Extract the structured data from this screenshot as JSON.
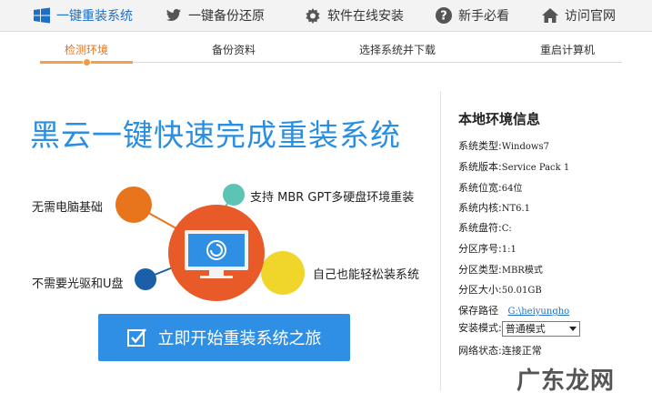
{
  "toolbar": {
    "items": [
      {
        "label": "一键重装系统",
        "icon": "windows-logo-icon"
      },
      {
        "label": "一键备份还原",
        "icon": "twitter-bird-icon"
      },
      {
        "label": "软件在线安装",
        "icon": "gear-icon"
      },
      {
        "label": "新手必看",
        "icon": "help-icon"
      },
      {
        "label": "访问官网",
        "icon": "home-icon"
      }
    ]
  },
  "steps": {
    "items": [
      "检测环境",
      "备份资料",
      "选择系统并下载",
      "重启计算机"
    ],
    "active_index": 0
  },
  "main": {
    "headline": "黑云一键快速完成重装系统",
    "features": {
      "no_skill": "无需电脑基础",
      "no_drive": "不需要光驱和U盘",
      "mbr_gpt": "支持 MBR GPT多硬盘环境重装",
      "self_install": "自己也能轻松装系统"
    },
    "start_button": "立即开始重装系统之旅"
  },
  "info": {
    "title": "本地环境信息",
    "os_type_label": "系统类型:",
    "os_type": "Windows7",
    "os_version_label": "系统版本:",
    "os_version": "Service Pack 1",
    "os_bits_label": "系统位宽:",
    "os_bits": "64位",
    "kernel_label": "系统内核:",
    "kernel": "NT6.1",
    "drive_label": "系统盘符:",
    "drive": "C:",
    "partition_no_label": "分区序号:",
    "partition_no": "1:1",
    "partition_type_label": "分区类型:",
    "partition_type": "MBR模式",
    "partition_size_label": "分区大小:",
    "partition_size": "50.01GB",
    "save_path_label": "保存路径",
    "save_path": "G:\\heiyungho",
    "install_mode_label": "安装模式:",
    "install_mode": "普通模式",
    "network_label": "网络状态:",
    "network": "连接正常"
  },
  "watermark": "广东龙网",
  "colors": {
    "accent": "#2f8fe4",
    "active_step": "#e8741c",
    "orange_circle": "#e8741c",
    "teal_circle": "#5cc3b5",
    "navy_circle": "#1a5fa8",
    "yellow_circle": "#f0d52a",
    "center_circle": "#e85a28"
  }
}
